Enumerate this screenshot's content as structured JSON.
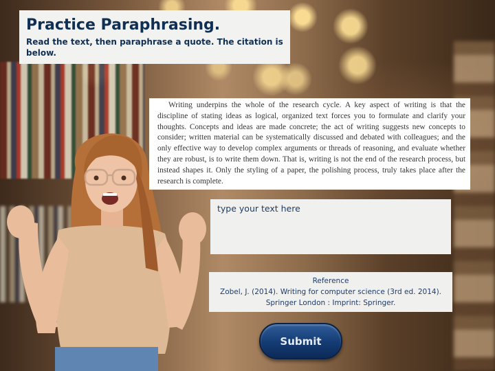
{
  "header": {
    "title": "Practice Paraphrasing.",
    "instructions": "Read the text, then paraphrase a quote. The citation is below."
  },
  "passage": {
    "text": "Writing underpins the whole of the research cycle. A key aspect of writing is that the discipline of stating ideas as logical, organized text forces you to formulate and clarify your thoughts. Concepts and ideas are made concrete; the act of writing suggests new concepts to consider; written material can be systematically discussed and debated with colleagues; and the only effective way to develop complex arguments or threads of reasoning, and evaluate whether they are robust, is to write them down. That is, writing is not the end of the research process, but instead shapes it. Only the styling of a paper, the polishing process, truly takes place after the research is complete."
  },
  "answer_input": {
    "placeholder": "type your text here",
    "value": ""
  },
  "reference": {
    "heading": "Reference",
    "line1": "Zobel, J. (2014). Writing for computer science (3rd ed. 2014).",
    "line2": "Springer London : Imprint: Springer."
  },
  "submit_label": "Submit",
  "colors": {
    "title": "#0f2f55",
    "button": "#143b73",
    "text": "#1f3b66"
  },
  "icons": {
    "background": "blurred-library-photo",
    "person": "excited-woman-photo"
  }
}
